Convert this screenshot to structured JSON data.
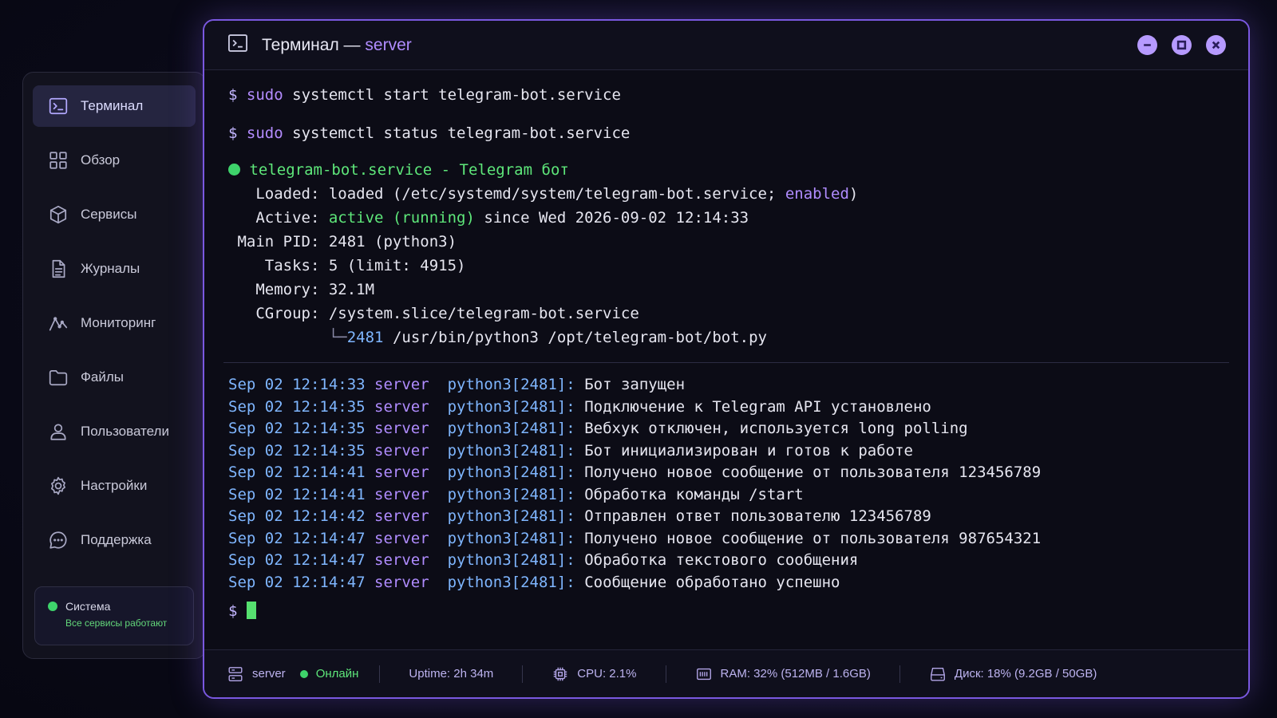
{
  "sidebar": {
    "items": [
      {
        "label": "Терминал",
        "icon": "terminal-icon",
        "active": true
      },
      {
        "label": "Обзор",
        "icon": "grid-icon"
      },
      {
        "label": "Сервисы",
        "icon": "cube-icon"
      },
      {
        "label": "Журналы",
        "icon": "document-icon"
      },
      {
        "label": "Мониторинг",
        "icon": "activity-icon"
      },
      {
        "label": "Файлы",
        "icon": "folder-icon"
      },
      {
        "label": "Пользователи",
        "icon": "user-icon"
      },
      {
        "label": "Настройки",
        "icon": "gear-icon"
      },
      {
        "label": "Поддержка",
        "icon": "chat-icon"
      }
    ],
    "system": {
      "title": "Система",
      "status": "Все сервисы работают"
    }
  },
  "window": {
    "title": "Терминал —",
    "host": "server"
  },
  "terminal": {
    "prompt": "$",
    "cmd1": {
      "sudo": "sudo",
      "rest": "systemctl start telegram-bot.service"
    },
    "cmd2": {
      "sudo": "sudo",
      "rest": "systemctl status telegram-bot.service"
    },
    "service_head": "telegram-bot.service - Telegram бот",
    "loaded_label": "Loaded:",
    "loaded_value": "loaded (/etc/systemd/system/telegram-bot.service;",
    "loaded_enabled": "enabled",
    "loaded_close": ")",
    "active_label": "Active:",
    "active_state": "active (running)",
    "active_since": "since Wed 2026-09-02 12:14:33",
    "pid_label": "Main PID:",
    "pid_value": "2481 (python3)",
    "tasks_label": "Tasks:",
    "tasks_value": "5 (limit: 4915)",
    "memory_label": "Memory:",
    "memory_value": "32.1M",
    "cgroup_label": "CGroup:",
    "cgroup_value": "/system.slice/telegram-bot.service",
    "tree_branch": "└─",
    "tree_pid": "2481",
    "tree_cmd": "/usr/bin/python3 /opt/telegram-bot/bot.py",
    "logs": [
      {
        "ts": "Sep 02 12:14:33",
        "host": "server",
        "proc": "python3[2481]:",
        "msg": "Бот запущен"
      },
      {
        "ts": "Sep 02 12:14:35",
        "host": "server",
        "proc": "python3[2481]:",
        "msg": "Подключение к Telegram API установлено"
      },
      {
        "ts": "Sep 02 12:14:35",
        "host": "server",
        "proc": "python3[2481]:",
        "msg": "Вебхук отключен, используется long polling"
      },
      {
        "ts": "Sep 02 12:14:35",
        "host": "server",
        "proc": "python3[2481]:",
        "msg": "Бот инициализирован и готов к работе"
      },
      {
        "ts": "Sep 02 12:14:41",
        "host": "server",
        "proc": "python3[2481]:",
        "msg": "Получено новое сообщение от пользователя 123456789"
      },
      {
        "ts": "Sep 02 12:14:41",
        "host": "server",
        "proc": "python3[2481]:",
        "msg": "Обработка команды /start"
      },
      {
        "ts": "Sep 02 12:14:42",
        "host": "server",
        "proc": "python3[2481]:",
        "msg": "Отправлен ответ пользователю 123456789"
      },
      {
        "ts": "Sep 02 12:14:47",
        "host": "server",
        "proc": "python3[2481]:",
        "msg": "Получено новое сообщение от пользователя 987654321"
      },
      {
        "ts": "Sep 02 12:14:47",
        "host": "server",
        "proc": "python3[2481]:",
        "msg": "Обработка текстового сообщения"
      },
      {
        "ts": "Sep 02 12:14:47",
        "host": "server",
        "proc": "python3[2481]:",
        "msg": "Сообщение обработано успешно"
      }
    ]
  },
  "status": {
    "host": "server",
    "online": "Онлайн",
    "uptime": "Uptime: 2h 34m",
    "cpu": "CPU: 2.1%",
    "ram": "RAM: 32% (512MB / 1.6GB)",
    "disk": "Диск: 18% (9.2GB / 50GB)"
  },
  "colors": {
    "accent": "#7a58e0",
    "online": "#3ed36b"
  }
}
